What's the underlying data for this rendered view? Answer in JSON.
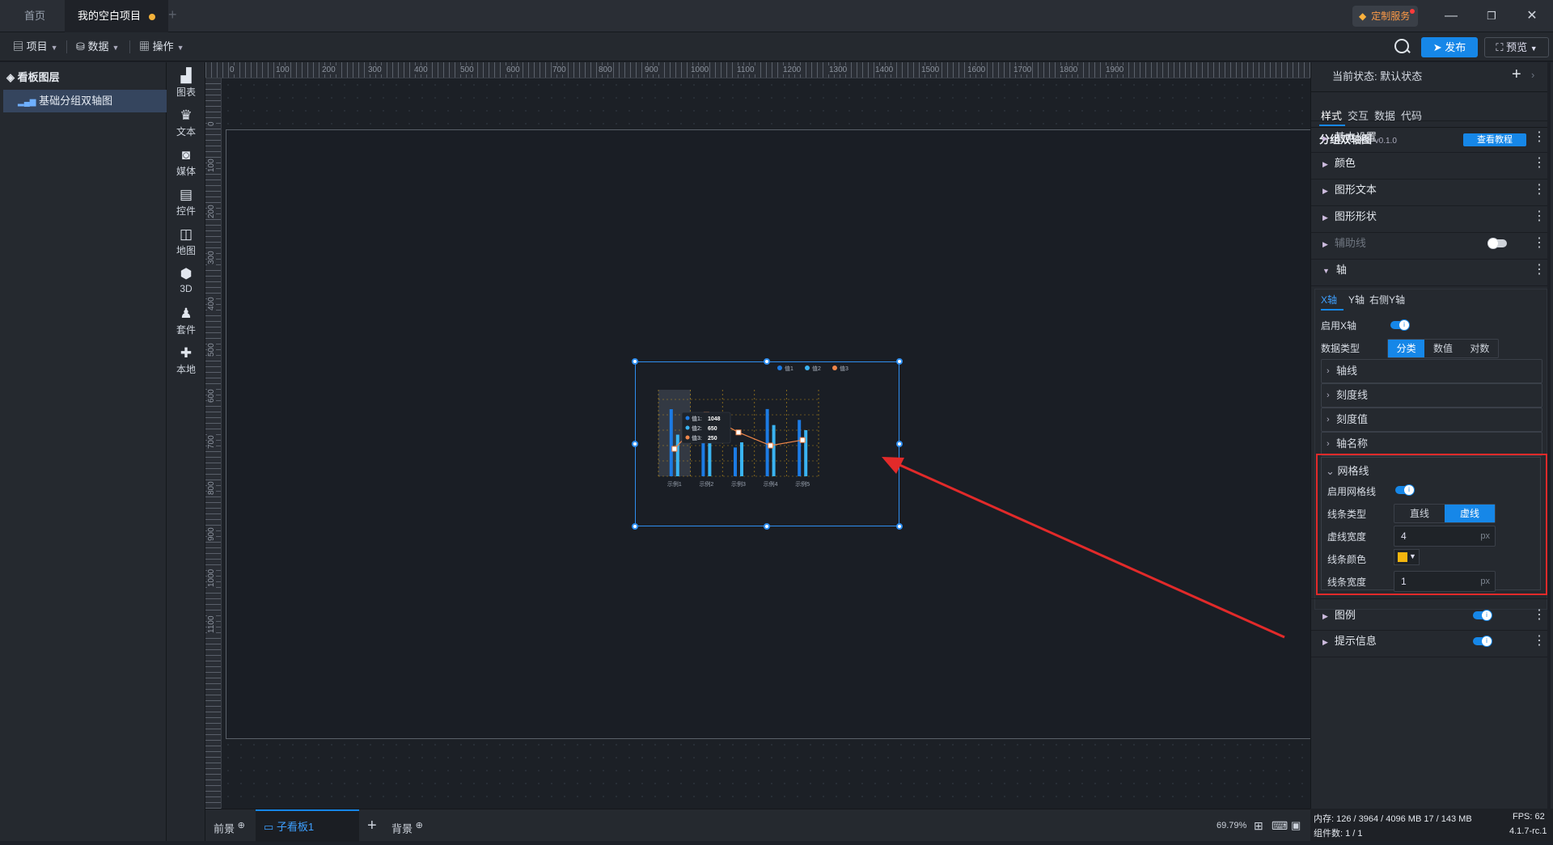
{
  "tabs": {
    "home": "首页",
    "project": "我的空白项目"
  },
  "title_actions": {
    "custom_service": "定制服务"
  },
  "toolbar": {
    "project": "项目",
    "data": "数据",
    "operate": "操作",
    "publish": "发布",
    "preview": "预览"
  },
  "layers": {
    "header": "看板图层",
    "item": "基础分组双轴图"
  },
  "tools": [
    {
      "label": "图表",
      "icon": "chart-icon"
    },
    {
      "label": "文本",
      "icon": "text-icon"
    },
    {
      "label": "媒体",
      "icon": "media-icon"
    },
    {
      "label": "控件",
      "icon": "widget-icon"
    },
    {
      "label": "地图",
      "icon": "map-icon"
    },
    {
      "label": "3D",
      "icon": "cube-icon"
    },
    {
      "label": "套件",
      "icon": "kit-icon"
    },
    {
      "label": "本地",
      "icon": "puzzle-icon"
    }
  ],
  "ruler": {
    "top_ticks": [
      "0",
      "100",
      "200",
      "300",
      "400",
      "500",
      "600",
      "700",
      "800",
      "900",
      "1000",
      "1100",
      "1200",
      "1300",
      "1400",
      "1500",
      "1600",
      "1700",
      "1800",
      "1900"
    ],
    "left_ticks": [
      "0",
      "100",
      "200",
      "300",
      "400",
      "500",
      "600",
      "700",
      "800",
      "900",
      "1000",
      "1100"
    ]
  },
  "chart_data": {
    "type": "bar",
    "categories": [
      "示例1",
      "示例2",
      "示例3",
      "示例4",
      "示例5"
    ],
    "series": [
      {
        "name": "值1",
        "values": [
          1048,
          700,
          450,
          1050,
          880
        ],
        "color": "#1c7be4"
      },
      {
        "name": "值2",
        "values": [
          650,
          520,
          530,
          800,
          720
        ],
        "color": "#3ab4f2"
      },
      {
        "name": "值3",
        "values": [
          250,
          560,
          400,
          280,
          330
        ],
        "color": "#f0864a",
        "chart_type": "line",
        "axis": "right"
      }
    ],
    "ylim": [
      0,
      1200
    ],
    "grid": "dashed",
    "grid_color": "#f2b516",
    "legend": "top-right",
    "tooltip": {
      "items": [
        {
          "name": "值1",
          "value": "1048"
        },
        {
          "name": "值2",
          "value": "650"
        },
        {
          "name": "值3",
          "value": "250"
        }
      ],
      "category": "示例1"
    }
  },
  "bottom": {
    "front": "前景",
    "sub_board": "子看板1",
    "background": "背景",
    "zoom": "69.79%"
  },
  "right": {
    "state_label": "当前状态:",
    "state_value": "默认状态",
    "tabs": [
      "样式",
      "交互",
      "数据",
      "代码"
    ],
    "component_name": "分组双轴图",
    "version": "v0.1.0",
    "tutorial": "查看教程",
    "sections": {
      "basic": "基本设置",
      "color": "颜色",
      "shape_text": "图形文本",
      "shape": "图形形状",
      "guide": "辅助线",
      "axis": "轴",
      "legend": "图例",
      "tooltip": "提示信息"
    },
    "axis_tabs": [
      "X轴",
      "Y轴",
      "右侧Y轴"
    ],
    "enable_x": "启用X轴",
    "data_type": "数据类型",
    "data_type_options": [
      "分类",
      "数值",
      "对数"
    ],
    "sub_sections": [
      "轴线",
      "刻度线",
      "刻度值",
      "轴名称"
    ],
    "grid": {
      "title": "网格线",
      "enable": "启用网格线",
      "line_type": "线条类型",
      "line_type_options": [
        "直线",
        "虚线"
      ],
      "dash_width": "虚线宽度",
      "dash_width_value": "4",
      "line_color": "线条颜色",
      "line_color_value": "#f5b60f",
      "line_width": "线条宽度",
      "line_width_value": "1",
      "unit": "px"
    }
  },
  "status": {
    "memory": "内存: 126 / 3964 / 4096 MB 17 / 143 MB",
    "fps": "FPS: 62",
    "components": "组件数: 1 / 1",
    "version": "4.1.7-rc.1"
  }
}
